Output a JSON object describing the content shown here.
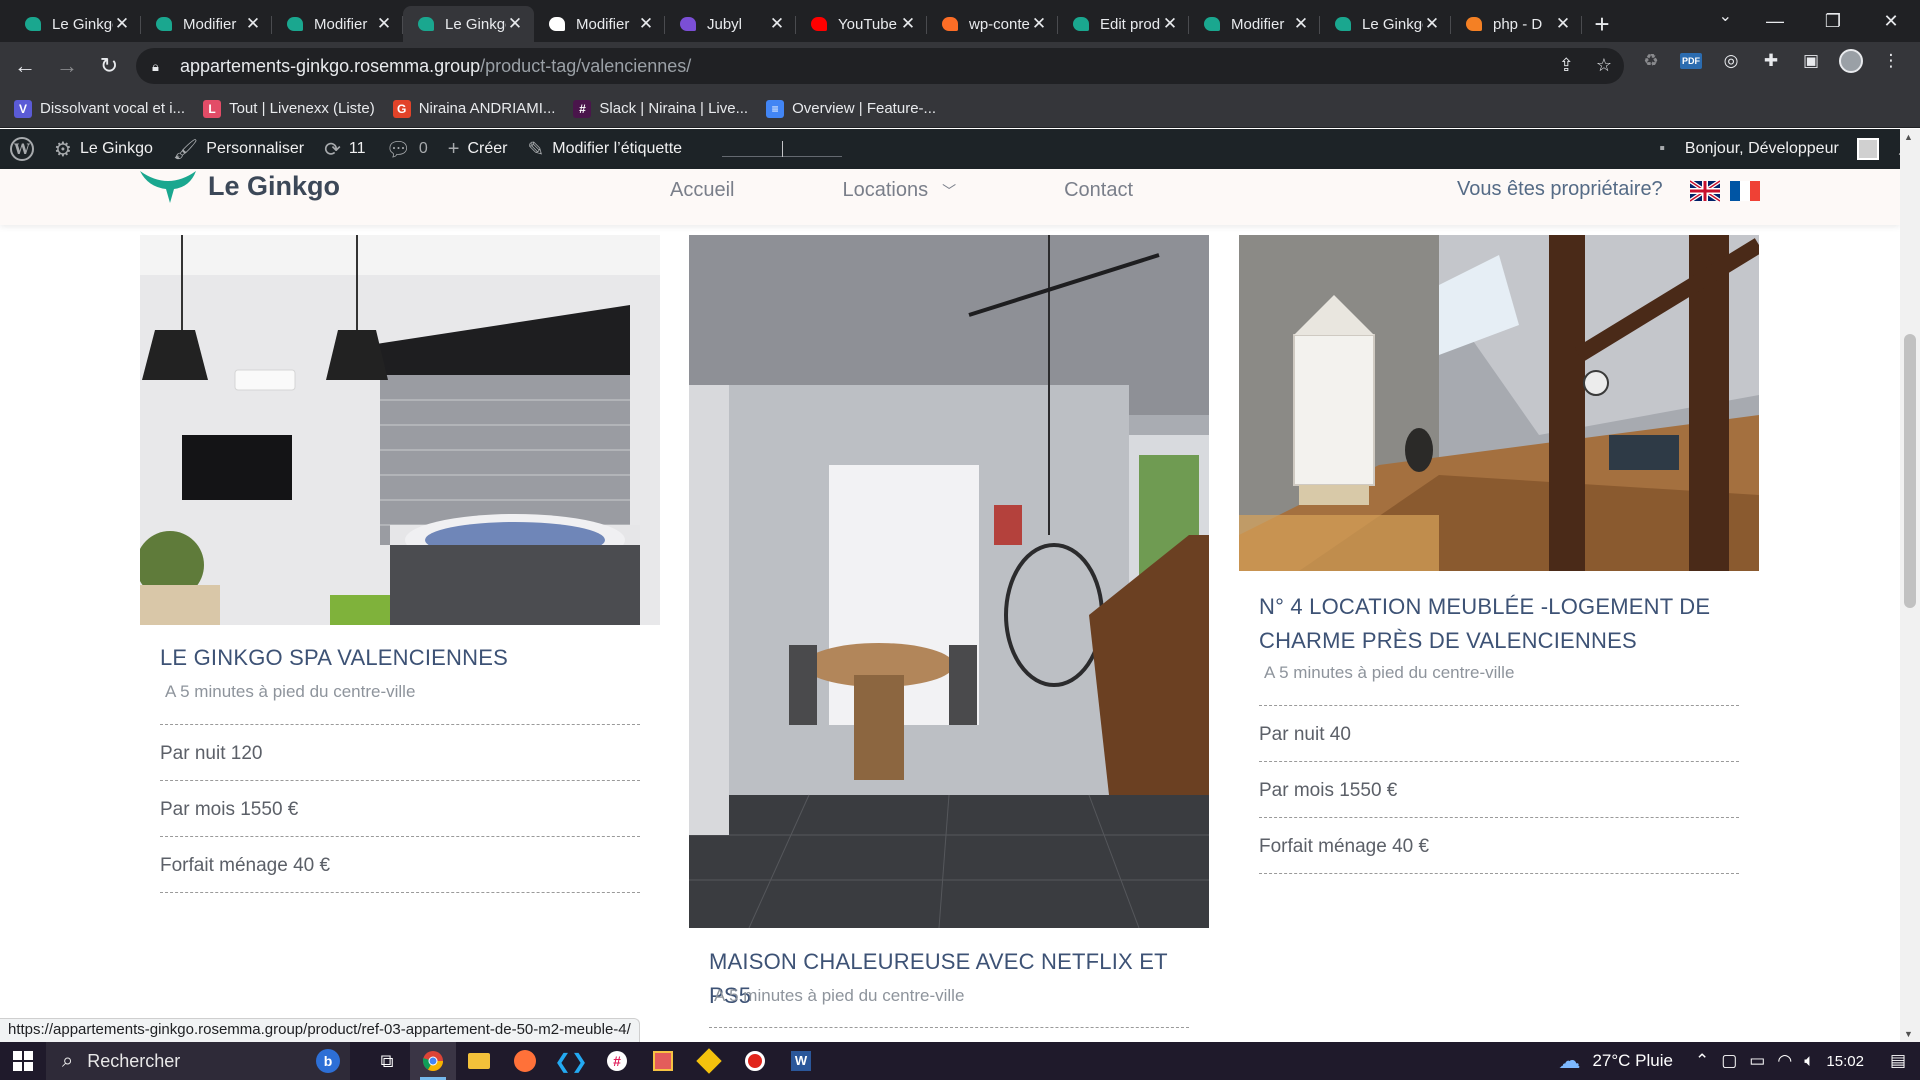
{
  "browser": {
    "tabs": [
      {
        "title": "Le Ginkgo",
        "favicon": "ginkgo-icon",
        "active": false
      },
      {
        "title": "Modifier",
        "favicon": "ginkgo-icon",
        "active": false
      },
      {
        "title": "Modifier",
        "favicon": "ginkgo-icon",
        "active": false
      },
      {
        "title": "Le Ginkgo",
        "favicon": "ginkgo-icon",
        "active": true
      },
      {
        "title": "Modifier",
        "favicon": "google-icon",
        "active": false
      },
      {
        "title": "Jubyl",
        "favicon": "jubyl-icon",
        "active": false
      },
      {
        "title": "YouTube",
        "favicon": "youtube-icon",
        "active": false
      },
      {
        "title": "wp-content",
        "favicon": "gitlab-icon",
        "active": false
      },
      {
        "title": "Edit product",
        "favicon": "ginkgo-icon",
        "active": false
      },
      {
        "title": "Modifier",
        "favicon": "ginkgo-icon",
        "active": false
      },
      {
        "title": "Le Ginkgo",
        "favicon": "ginkgo-icon",
        "active": false
      },
      {
        "title": "php - D",
        "favicon": "stackoverflow-icon",
        "active": false
      }
    ],
    "url_host": "appartements-ginkgo.rosemma.group",
    "url_path": "/product-tag/valenciennes/",
    "bookmarks": [
      {
        "label": "Dissolvant vocal et i...",
        "icon": "vocal-remover-icon",
        "color": "#5b5bd6",
        "glyph": "V"
      },
      {
        "label": "Tout | Livenexx (Liste)",
        "icon": "livenexx-icon",
        "color": "#e34c67",
        "glyph": "L"
      },
      {
        "label": "Niraina ANDRIAMI...",
        "icon": "gitlab-icon",
        "color": "#e24329",
        "glyph": "G"
      },
      {
        "label": "Slack | Niraina | Live...",
        "icon": "slack-icon",
        "color": "#4a154b",
        "glyph": "#"
      },
      {
        "label": "Overview | Feature-...",
        "icon": "document-icon",
        "color": "#4285f4",
        "glyph": "≡"
      }
    ],
    "status_url": "https://appartements-ginkgo.rosemma.group/product/ref-03-appartement-de-50-m2-meuble-4/"
  },
  "wp_admin": {
    "site": "Le Ginkgo",
    "customize": "Personnaliser",
    "updates": "11",
    "comments": "0",
    "create": "Créer",
    "edit_tag": "Modifier l’étiquette",
    "greeting": "Bonjour, Développeur"
  },
  "site": {
    "brand": "Le Ginkgo",
    "menu": [
      "Accueil",
      "Locations",
      "Contact"
    ],
    "owner_link": "Vous êtes propriétaire?",
    "languages": [
      "English",
      "Français"
    ]
  },
  "products": [
    {
      "title": "LE GINKGO SPA VALENCIENNES",
      "subtitle": "A 5 minutes à pied du centre-ville",
      "per_night": "Par nuit 120",
      "per_month": "Par mois 1550 €",
      "cleaning": "Forfait ménage 40 €"
    },
    {
      "title": "MAISON CHALEUREUSE AVEC NETFLIX ET PS5",
      "subtitle": "A 5 minutes à pied du centre-ville"
    },
    {
      "title_line1": "N° 4 LOCATION MEUBLÉE -LOGEMENT DE",
      "title_line2": "CHARME PRÈS DE VALENCIENNES",
      "subtitle": "A 5 minutes à pied du centre-ville",
      "per_night": "Par nuit 40",
      "per_month": "Par mois 1550 €",
      "cleaning": "Forfait ménage 40 €"
    }
  ],
  "taskbar": {
    "search_placeholder": "Rechercher",
    "weather": "27°C Pluie",
    "time": "15:02"
  }
}
